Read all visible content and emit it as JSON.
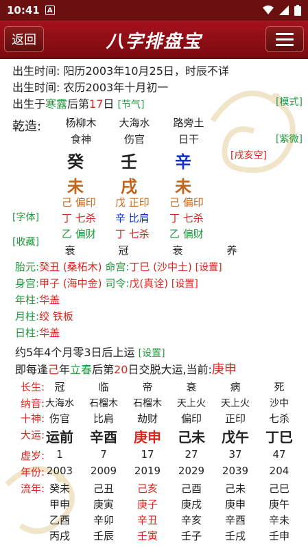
{
  "status": {
    "time": "10:41",
    "notif_icon": "A"
  },
  "header": {
    "back_label": "返回",
    "title": "八字排盘宝"
  },
  "birth": {
    "line1": "出生时间: 阳历2003年10月25日，时辰不详",
    "line2": "出生时间: 农历2003年十月初一",
    "line3_pre": "出生于",
    "line3_jieqi": "寒露",
    "line3_mid": "后第",
    "line3_day": "17",
    "line3_post": "日",
    "jieqi_link": "[节气]",
    "mode_link": "[模式]"
  },
  "chart": {
    "label": "乾造:",
    "nayin": [
      "杨柳木",
      "大海水",
      "路旁土"
    ],
    "shishen": [
      "食神",
      "伤官",
      "日干"
    ],
    "gan": [
      "癸",
      "壬",
      "辛"
    ],
    "zhi": [
      "未",
      "戌",
      "未"
    ],
    "canggan_row1": [
      "己 偏印",
      "戊 正印",
      "己 偏印"
    ],
    "canggan_row2": [
      "丁 七杀",
      "辛 比肩",
      "丁 七杀"
    ],
    "canggan_row3": [
      "乙 偏财",
      "丁 七杀",
      "乙 偏财"
    ],
    "changsheng": [
      "衰",
      "冠",
      "衰",
      "养"
    ],
    "ziwei_link": "[紫微]",
    "kong_label": "[戌亥空]",
    "font_link": "[字体]",
    "fav_link": "[收藏]"
  },
  "extra": {
    "taiyuan_label": "胎元:",
    "taiyuan_val": "癸丑 (桑柘木)",
    "minggong_label": "命宫:",
    "minggong_val": "丁巳 (沙中土)",
    "shengong_label": "身宫:",
    "shengong_val": "甲子 (海中金)",
    "siling_label": "司令:",
    "siling_val": "戊(真诠)",
    "set1": "[设置]",
    "set2": "[设置]",
    "nianzhu_label": "年柱:",
    "nianzhu_val": "华盖",
    "yuezhu_label": "月柱:",
    "yuezhu_val": "绞 铁板",
    "rizhu_label": "日柱:",
    "rizhu_val": "华盖"
  },
  "yun": {
    "start_text": "约5年4个月零3日后上运",
    "start_set": "[设置]",
    "jiao_pre": "即每逢",
    "jiao_gan": "己",
    "jiao_mid1": "年",
    "jiao_jieqi": "立春",
    "jiao_mid2": "后第",
    "jiao_day": "20",
    "jiao_post": "日交脱大运,当前:",
    "current": "庚申"
  },
  "dayun": {
    "labels": [
      "长生:",
      "纳音:",
      "十神:",
      "大运:",
      "虚岁:",
      "年份:",
      "流年:"
    ],
    "changsheng": [
      "冠",
      "临",
      "帝",
      "衰",
      "病",
      "死"
    ],
    "nayin": [
      "大海水",
      "石榴木",
      "石榴木",
      "天上火",
      "天上火",
      "沙中"
    ],
    "shishen": [
      "伤官",
      "比肩",
      "劫财",
      "偏印",
      "正印",
      "七杀"
    ],
    "dayun": [
      "运前",
      "辛酉",
      "庚申",
      "己未",
      "戊午",
      "丁巳"
    ],
    "sui": [
      "1",
      "7",
      "17",
      "27",
      "37",
      "47"
    ],
    "year": [
      "2003",
      "2009",
      "2019",
      "2029",
      "2039",
      "204"
    ],
    "liunian": [
      [
        "癸未",
        "己丑",
        "己亥",
        "己酉",
        "己未",
        "己巳"
      ],
      [
        "甲申",
        "庚寅",
        "庚子",
        "庚戌",
        "庚申",
        "庚午"
      ],
      [
        "乙酉",
        "辛卯",
        "辛丑",
        "辛亥",
        "辛酉",
        "辛未"
      ],
      [
        "丙戌",
        "壬辰",
        "壬寅",
        "壬子",
        "壬戌",
        "壬申"
      ]
    ]
  }
}
